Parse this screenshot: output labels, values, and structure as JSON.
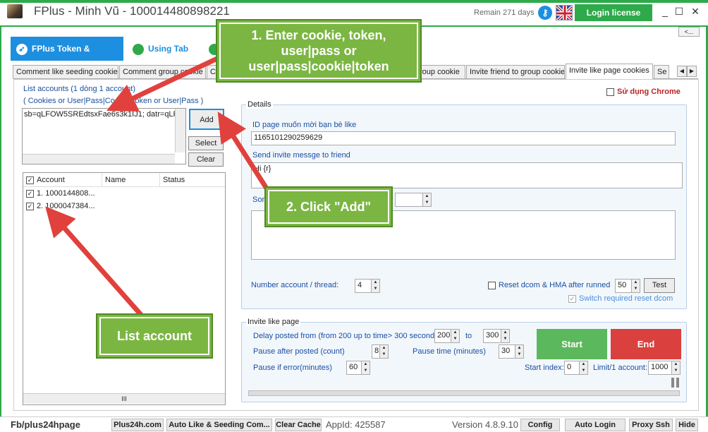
{
  "window": {
    "title": "FPlus - Minh Vũ - 100014480898221",
    "remain": "Remain 271 days",
    "login_label": "Login license",
    "minimize": "_",
    "maximize": "☐",
    "close": "✕",
    "back_label": "<..."
  },
  "main_tabs": [
    {
      "label": "FPlus Token & Cookie",
      "active": true
    },
    {
      "label": "Using Tab",
      "active": false
    }
  ],
  "sub_tabs": [
    {
      "label": "Comment like seeding cookie"
    },
    {
      "label": "Comment group cookie"
    },
    {
      "label": "Co"
    },
    {
      "label": "roup cookie"
    },
    {
      "label": "Invite friend to group cookie"
    },
    {
      "label": "Invite like page cookies",
      "active": true
    },
    {
      "label": "Se"
    }
  ],
  "accounts": {
    "title": "List accounts (1 dòng 1 account)",
    "subtitle": "( Cookies or User|Pass|Cookie|Token or User|Pass )",
    "input_value": "sb=qLFOW5SREdtsxFae6s3k1IJ1; datr=qLF",
    "add_label": "Add",
    "select_label": "Select",
    "clear_label": "Clear",
    "columns": [
      "Account",
      "Name",
      "Status"
    ],
    "rows": [
      {
        "account": "1. 1000144808...",
        "checked": true
      },
      {
        "account": "2. 1000047384...",
        "checked": true
      }
    ],
    "hscroll_label": "III"
  },
  "use_chrome_label": "Sử dụng Chrome",
  "details": {
    "title": "Details",
    "page_id_label": "ID page muốn mời bạn bè like",
    "page_id_value": "1165101290259629",
    "message_label": "Send invite messge to friend",
    "message_value": "Hi {r}",
    "some_label": "Sor",
    "number_thread_label": "Number account / thread:",
    "number_thread_value": "4",
    "reset_dcom_label": "Reset dcom & HMA after runned",
    "reset_value": "50",
    "test_label": "Test",
    "switch_label": "Switch required reset dcom"
  },
  "invite": {
    "title": "Invite like page",
    "delay_label": "Delay posted from (from 200 up to time> 300 seconds)",
    "delay_from": "200",
    "to_label": "to",
    "delay_to": "300",
    "pause_after_label": "Pause after posted (count)",
    "pause_after_value": "8",
    "pause_time_label": "Pause time (minutes)",
    "pause_time_value": "30",
    "pause_error_label": "Pause if error(minutes)",
    "pause_error_value": "60",
    "start_index_label": "Start index:",
    "start_index_value": "0",
    "limit_label": "Limit/1 account:",
    "limit_value": "1000",
    "start_label": "Start",
    "end_label": "End"
  },
  "callouts": {
    "step1": "1. Enter cookie, token, user|pass or user|pass|cookie|token",
    "step2": "2. Click \"Add\"",
    "list": "List account"
  },
  "statusbar": {
    "page": "Fb/plus24hpage",
    "site": "Plus24h.com",
    "auto_like": "Auto Like & Seeding Com...",
    "clear_cache": "Clear Cache",
    "appid": "AppId: 425587",
    "version": "Version 4.8.9.10",
    "config": "Config",
    "auto_login": "Auto Login",
    "proxy": "Proxy Ssh",
    "hide": "Hide"
  },
  "colors": {
    "accent_green": "#2eaa4a",
    "tab_blue": "#1d8fe0",
    "callout_green": "#7bb642",
    "arrow_red": "#e0413d",
    "end_red": "#d9403e",
    "start_green": "#5cb85c"
  }
}
